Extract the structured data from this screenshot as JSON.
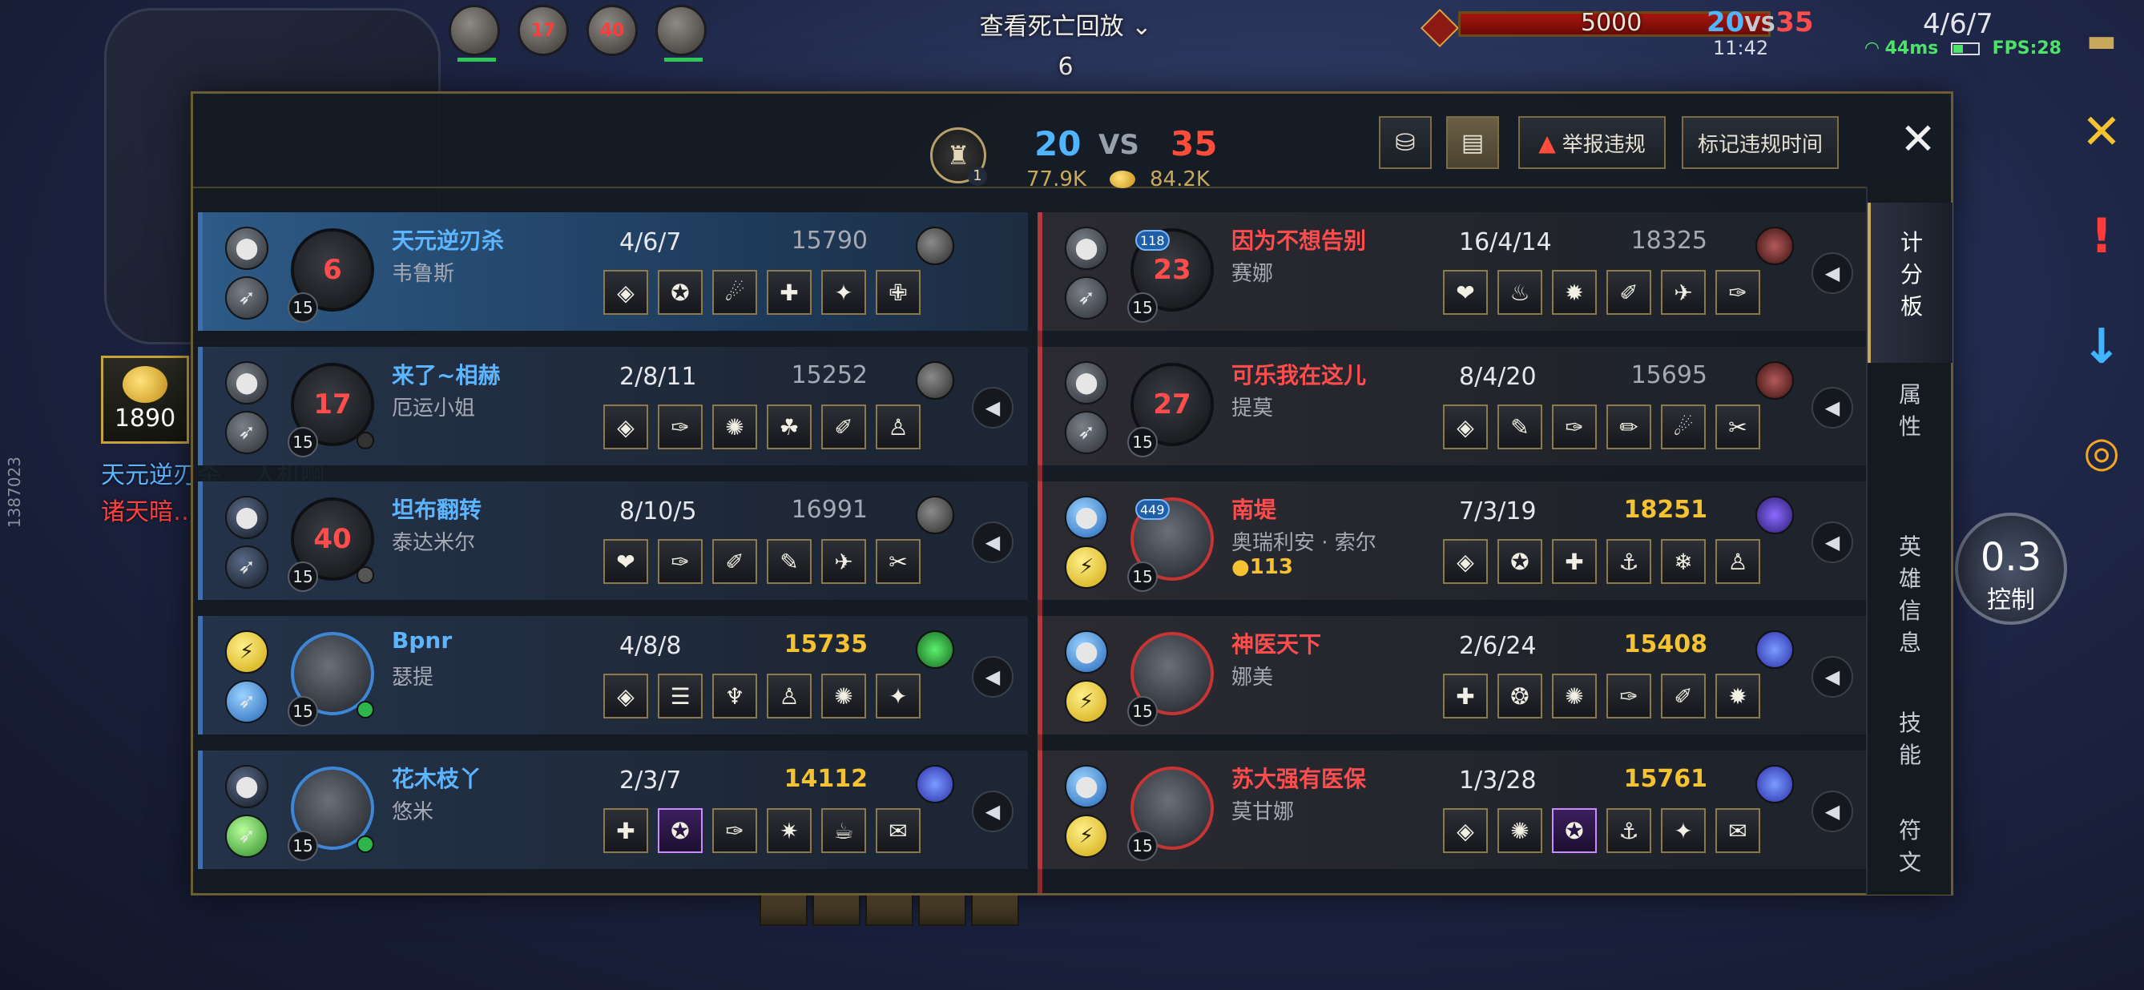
{
  "hud": {
    "death_replay_label": "查看死亡回放",
    "death_replay_chevron": "⌄",
    "death_count": "6",
    "boss_value": "5000",
    "score_blue": "20",
    "score_vs": "VS",
    "score_red": "35",
    "game_time": "11:42",
    "my_kda": "4/6/7",
    "ping": "44ms",
    "fps": "FPS:28",
    "gold": "1890",
    "chat_line_1": "天元逆刃杀 …人机啊",
    "chat_line_2": "诸天暗…",
    "side_id": "1387023",
    "control_value": "0.3",
    "control_label": "控制",
    "top_portraits": [
      {
        "death_timer": ""
      },
      {
        "death_timer": "17"
      },
      {
        "death_timer": "40"
      },
      {
        "death_timer": ""
      }
    ],
    "icons": {
      "close_hud": "close-icon",
      "ping_warn": "exclamation-icon",
      "arrow": "arrow-down-icon",
      "lifebuoy": "lifebuoy-icon",
      "chat": "chat-icon"
    }
  },
  "header": {
    "dragon_count": "1",
    "team_blue_kills": "20",
    "vs_label": "VS",
    "team_red_kills": "35",
    "team_blue_gold": "77.9K",
    "team_red_gold": "84.2K",
    "report_label": "举报违规",
    "mark_label": "标记违规时间",
    "close_glyph": "✕"
  },
  "blue_team": [
    {
      "name": "天元逆刃杀",
      "champion": "韦鲁斯",
      "kda": "4/6/7",
      "gold": "15790",
      "level": "15",
      "death_timer": "6",
      "self": true,
      "gold_hi": false,
      "items": [
        "◈",
        "✪",
        "☄",
        "✚",
        "✦",
        "✙"
      ]
    },
    {
      "name": "来了~相赫",
      "champion": "厄运小姐",
      "kda": "2/8/11",
      "gold": "15252",
      "level": "15",
      "death_timer": "17",
      "self": false,
      "gold_hi": false,
      "items": [
        "◈",
        "✑",
        "✺",
        "☘",
        "✐",
        "♙"
      ]
    },
    {
      "name": "坦布翻转",
      "champion": "泰达米尔",
      "kda": "8/10/5",
      "gold": "16991",
      "level": "15",
      "death_timer": "40",
      "self": false,
      "gold_hi": false,
      "items": [
        "❤",
        "✑",
        "✐",
        "✎",
        "✈",
        "✂"
      ]
    },
    {
      "name": "Bpnr",
      "champion": "瑟提",
      "kda": "4/8/8",
      "gold": "15735",
      "level": "15",
      "death_timer": "",
      "self": false,
      "gold_hi": true,
      "items": [
        "◈",
        "☰",
        "♆",
        "♙",
        "✺",
        "✦"
      ]
    },
    {
      "name": "花木枝丫",
      "champion": "悠米",
      "kda": "2/3/7",
      "gold": "14112",
      "level": "15",
      "death_timer": "",
      "self": false,
      "gold_hi": true,
      "items": [
        "✚",
        "✪",
        "✑",
        "✷",
        "☕",
        "✉"
      ]
    }
  ],
  "red_team": [
    {
      "name": "因为不想告别",
      "champion": "赛娜",
      "kda": "16/4/14",
      "gold": "18325",
      "level": "15",
      "death_timer": "23",
      "badge": "118",
      "gold_hi": false,
      "items": [
        "❤",
        "♨",
        "✹",
        "✐",
        "✈",
        "✑"
      ]
    },
    {
      "name": "可乐我在这儿",
      "champion": "提莫",
      "kda": "8/4/20",
      "gold": "15695",
      "level": "15",
      "death_timer": "27",
      "badge": "",
      "gold_hi": false,
      "items": [
        "◈",
        "✎",
        "✑",
        "✏",
        "☄",
        "✂"
      ]
    },
    {
      "name": "南堤",
      "champion": "奥瑞利安 · 索尔",
      "kda": "7/3/19",
      "gold": "18251",
      "level": "15",
      "death_timer": "",
      "badge": "449",
      "gold_hi": true,
      "bounty": "113",
      "items": [
        "◈",
        "✪",
        "✚",
        "⚓",
        "❄",
        "♙"
      ]
    },
    {
      "name": "神医天下",
      "champion": "娜美",
      "kda": "2/6/24",
      "gold": "15408",
      "level": "15",
      "death_timer": "",
      "badge": "",
      "gold_hi": true,
      "items": [
        "✚",
        "❂",
        "✺",
        "✑",
        "✐",
        "✹"
      ]
    },
    {
      "name": "苏大强有医保",
      "champion": "莫甘娜",
      "kda": "1/3/28",
      "gold": "15761",
      "level": "15",
      "death_timer": "",
      "badge": "",
      "gold_hi": true,
      "items": [
        "◈",
        "✺",
        "✪",
        "⚓",
        "✦",
        "✉"
      ]
    }
  ],
  "tabs": [
    "计分板",
    "属性",
    "英雄信息",
    "技能",
    "符文"
  ]
}
